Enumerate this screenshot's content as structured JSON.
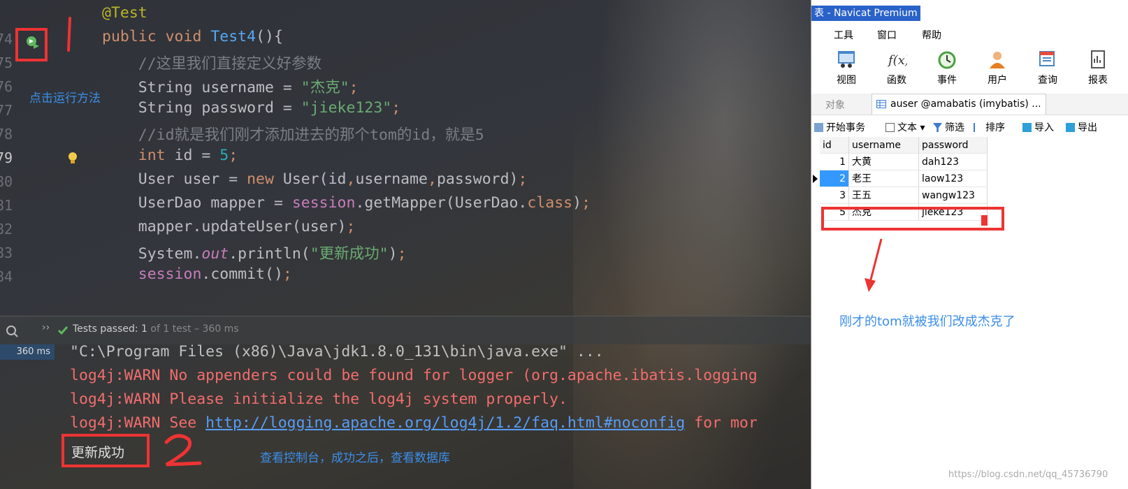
{
  "editor": {
    "line_numbers": [
      "74",
      "75",
      "76",
      "77",
      "78",
      "79",
      "80",
      "81",
      "82",
      "83",
      "84"
    ],
    "current_line": "79",
    "lines": [
      {
        "parts": [
          {
            "t": "@Test",
            "c": "ann"
          }
        ]
      },
      {
        "parts": [
          {
            "t": "public ",
            "c": "kw"
          },
          {
            "t": "void ",
            "c": "kw"
          },
          {
            "t": "Test4",
            "c": "fn"
          },
          {
            "t": "(){",
            "c": "typ"
          }
        ]
      },
      {
        "parts": [
          {
            "t": "    //这里我们直接定义好参数",
            "c": "cmt"
          }
        ]
      },
      {
        "parts": [
          {
            "t": "    String username = ",
            "c": "typ"
          },
          {
            "t": "\"杰克\"",
            "c": "str"
          },
          {
            "t": ";",
            "c": "kw"
          }
        ]
      },
      {
        "parts": [
          {
            "t": "    String password = ",
            "c": "typ"
          },
          {
            "t": "\"jieke123\"",
            "c": "str"
          },
          {
            "t": ";",
            "c": "kw"
          }
        ]
      },
      {
        "parts": [
          {
            "t": "    //id就是我们刚才添加进去的那个tom的id，就是5",
            "c": "cmt"
          }
        ]
      },
      {
        "parts": [
          {
            "t": "    int ",
            "c": "kw"
          },
          {
            "t": "id = ",
            "c": "typ"
          },
          {
            "t": "5",
            "c": "num"
          },
          {
            "t": ";",
            "c": "kw"
          }
        ]
      },
      {
        "parts": [
          {
            "t": "    User user = ",
            "c": "typ"
          },
          {
            "t": "new ",
            "c": "kw"
          },
          {
            "t": "User(id",
            "c": "typ"
          },
          {
            "t": ",",
            "c": "kw"
          },
          {
            "t": "username",
            "c": "typ"
          },
          {
            "t": ",",
            "c": "kw"
          },
          {
            "t": "password)",
            "c": "typ"
          },
          {
            "t": ";",
            "c": "kw"
          }
        ]
      },
      {
        "parts": [
          {
            "t": "    UserDao mapper = ",
            "c": "typ"
          },
          {
            "t": "session",
            "c": "fld"
          },
          {
            "t": ".getMapper(UserDao.",
            "c": "typ"
          },
          {
            "t": "class",
            "c": "kw"
          },
          {
            "t": ")",
            "c": "typ"
          },
          {
            "t": ";",
            "c": "kw"
          }
        ]
      },
      {
        "parts": [
          {
            "t": "    mapper.updateUser(user)",
            "c": "typ"
          },
          {
            "t": ";",
            "c": "kw"
          }
        ]
      },
      {
        "parts": [
          {
            "t": "    System.",
            "c": "typ"
          },
          {
            "t": "out",
            "c": "fld ital"
          },
          {
            "t": ".println(",
            "c": "typ"
          },
          {
            "t": "\"更新成功\"",
            "c": "str"
          },
          {
            "t": ")",
            "c": "typ"
          },
          {
            "t": ";",
            "c": "kw"
          }
        ]
      },
      {
        "parts": [
          {
            "t": "    ",
            "c": "typ"
          },
          {
            "t": "session",
            "c": "fld"
          },
          {
            "t": ".commit()",
            "c": "typ"
          },
          {
            "t": ";",
            "c": "kw"
          }
        ]
      }
    ],
    "annotation_run": "点击运行方法",
    "annotation_one": "1"
  },
  "test_bar": {
    "passed_label": "Tests passed: ",
    "passed_count": "1",
    "passed_rest": " of 1 test – 360 ms"
  },
  "console": {
    "time": "360 ms",
    "cmd": "\"C:\\Program Files (x86)\\Java\\jdk1.8.0_131\\bin\\java.exe\" ...",
    "warn1": "log4j:WARN No appenders could be found for logger (org.apache.ibatis.logging",
    "warn2": "log4j:WARN Please initialize the log4j system properly.",
    "warn3_prefix": "log4j:WARN See ",
    "warn3_link": "http://logging.apache.org/log4j/1.2/faq.html#noconfig",
    "warn3_suffix": " for mor",
    "success": "更新成功",
    "annotation_two": "2",
    "annotation_note": "查看控制台，成功之后，查看数据库"
  },
  "navicat": {
    "title": "表 - Navicat Premium",
    "menu": [
      "工具",
      "窗口",
      "帮助"
    ],
    "toolbar": [
      "视图",
      "函数",
      "事件",
      "用户",
      "查询",
      "报表"
    ],
    "tab_objects": "对象",
    "tab_active": "auser @amabatis (imybatis) ...",
    "actions": [
      "开始事务",
      "文本",
      "筛选",
      "排序",
      "导入",
      "导出"
    ],
    "columns": [
      "id",
      "username",
      "password"
    ],
    "rows": [
      {
        "id": "1",
        "username": "大黄",
        "password": "dah123"
      },
      {
        "id": "2",
        "username": "老王",
        "password": "laow123"
      },
      {
        "id": "3",
        "username": "王五",
        "password": "wangw123"
      },
      {
        "id": "5",
        "username": "杰克",
        "password": "jieke123"
      }
    ],
    "note": "刚才的tom就被我们改成杰克了",
    "watermark": "https://blog.csdn.net/qq_45736790"
  }
}
